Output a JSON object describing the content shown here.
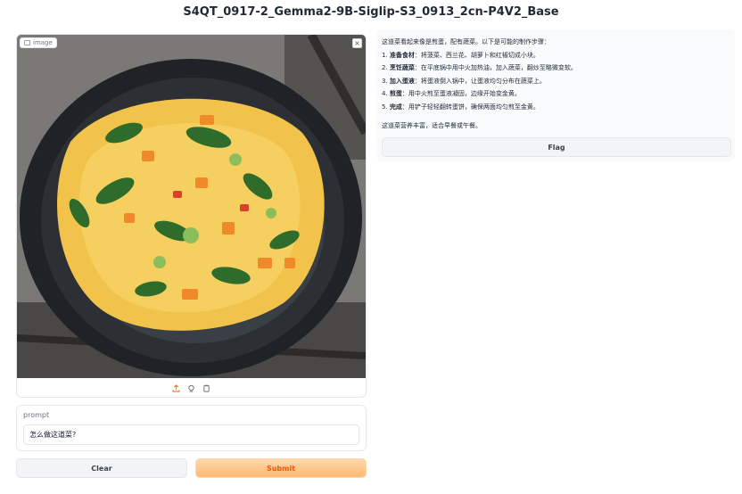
{
  "app": {
    "title": "S4QT_0917-2_Gemma2-9B-Siglip-S3_0913_2cn-P4V2_Base"
  },
  "image_input": {
    "label": "image",
    "close_symbol": "×",
    "tools": [
      "upload-icon",
      "camera-icon",
      "clipboard-icon"
    ],
    "photo_description_icon": "omelette-photo"
  },
  "prompt": {
    "label": "prompt",
    "value": "怎么做这道菜?"
  },
  "buttons": {
    "clear": "Clear",
    "submit": "Submit",
    "flag": "Flag"
  },
  "output": {
    "intro": "这道菜看起来像是煎蛋，配有蔬菜。以下是可能的制作步骤：",
    "steps": [
      {
        "num": "1.",
        "bold": "准备食材",
        "text": "：将菠菜、西兰花、胡萝卜和红椒切成小块。"
      },
      {
        "num": "2.",
        "bold": "烹饪蔬菜",
        "text": "：在平底锅中用中火加热油，加入蔬菜，翻炒至略微变软。"
      },
      {
        "num": "3.",
        "bold": "加入蛋液",
        "text": "：将蛋液倒入锅中，让蛋液均匀分布在蔬菜上。"
      },
      {
        "num": "4.",
        "bold": "煎蛋",
        "text": "：用中火煎至蛋液凝固，边缘开始变金黄。"
      },
      {
        "num": "5.",
        "bold": "完成",
        "text": "：用铲子轻轻翻转蛋饼，确保两面均匀煎至金黄。"
      }
    ],
    "outro": "这道菜营养丰富，适合早餐或午餐。"
  },
  "colors": {
    "accent": "#f97316",
    "submit_bg": "#fdba74",
    "panel_bg": "#f9fafb"
  }
}
